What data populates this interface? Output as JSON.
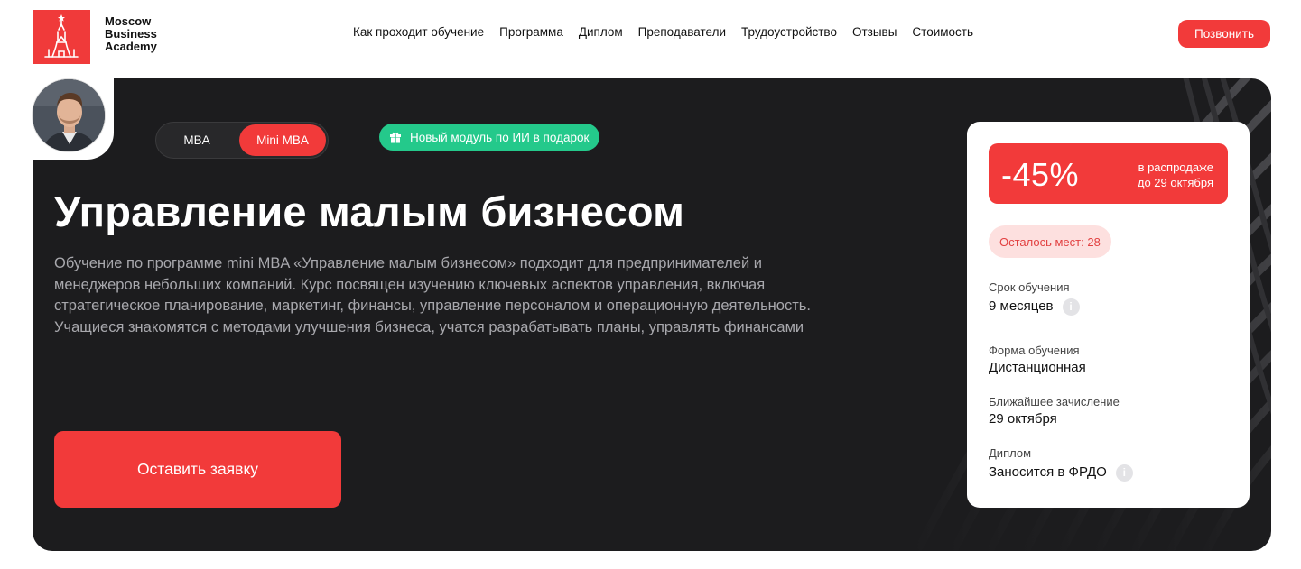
{
  "header": {
    "logo_lines": [
      "Moscow",
      "Business",
      "Academy"
    ],
    "nav": [
      {
        "label": "Как проходит обучение"
      },
      {
        "label": "Программа"
      },
      {
        "label": "Диплом"
      },
      {
        "label": "Преподаватели"
      },
      {
        "label": "Трудоустройство"
      },
      {
        "label": "Отзывы"
      },
      {
        "label": "Стоимость"
      }
    ],
    "call_label": "Позвонить"
  },
  "hero": {
    "toggle": {
      "options": [
        "MBA",
        "Mini MBA"
      ],
      "selected": "Mini MBA"
    },
    "badge": "Новый модуль по ИИ в подарок",
    "title": "Управление малым бизнесом",
    "description": "Обучение по программе mini MBA «Управление малым бизнесом» подходит для предпринимателей и менеджеров небольших компаний. Курс посвящен изучению ключевых аспектов управления, включая стратегическое планирование, маркетинг, финансы, управление персоналом и операционную деятельность. Учащиеся знакомятся с методами улучшения бизнеса, учатся разрабатывать планы, управлять финансами",
    "apply_label": "Оставить заявку"
  },
  "card": {
    "discount": "-45%",
    "sale_note_line1": "в распродаже",
    "sale_note_line2": "до 29 октября",
    "seats": "Осталось мест: 28",
    "items": [
      {
        "label": "Срок обучения",
        "value": "9 месяцев",
        "info": true
      },
      {
        "label": "Форма обучения",
        "value": "Дистанционная",
        "info": false
      },
      {
        "label": "Ближайшее зачисление",
        "value": "29 октября",
        "info": false
      },
      {
        "label": "Диплом",
        "value": "Заносится в ФРДО",
        "info": true
      }
    ]
  },
  "colors": {
    "accent": "#f23a3a",
    "badge": "#24c98b",
    "hero_bg": "#1c1c1e"
  }
}
